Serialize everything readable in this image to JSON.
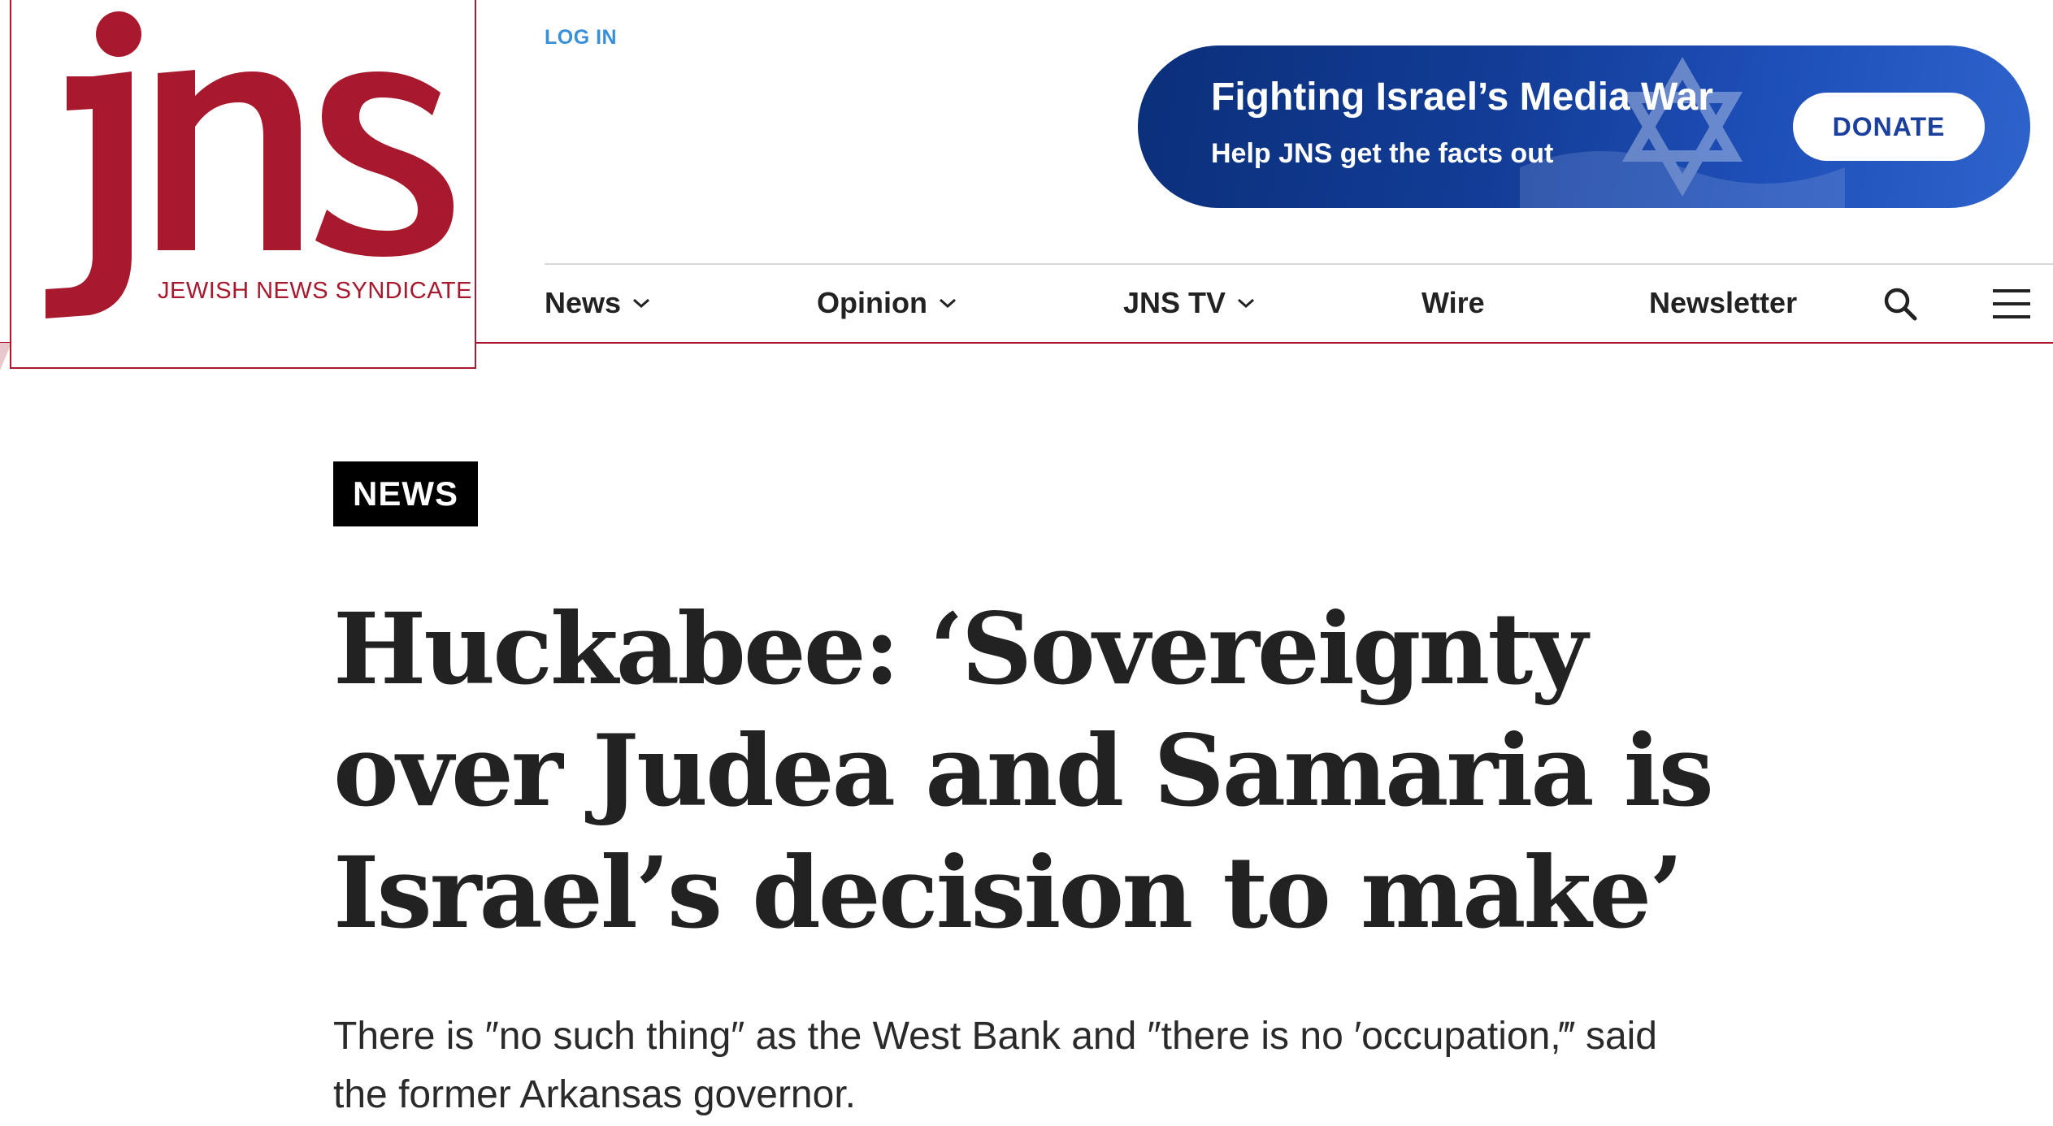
{
  "logo": {
    "wordmark": "jns",
    "tagline": "JEWISH NEWS SYNDICATE"
  },
  "header": {
    "login_label": "LOG IN"
  },
  "banner": {
    "title": "Fighting Israel’s Media War",
    "subtitle": "Help JNS get the facts out",
    "donate_label": "DONATE"
  },
  "nav": {
    "items": [
      {
        "label": "News",
        "dropdown": true
      },
      {
        "label": "Opinion",
        "dropdown": true
      },
      {
        "label": "JNS TV",
        "dropdown": true
      },
      {
        "label": "Wire",
        "dropdown": false
      },
      {
        "label": "Newsletter",
        "dropdown": false
      }
    ],
    "search_icon": "search-icon",
    "menu_icon": "hamburger-menu-icon"
  },
  "article": {
    "category": "NEWS",
    "headline_lines": [
      "Huckabee: ‘Sovereignty",
      "over Judea and Samaria is",
      "Israel’s decision to make’"
    ],
    "dek_lines": [
      "There is ″no such thing″ as the West Bank and ″there is no ′occupation,‴ said",
      "the former Arkansas governor."
    ]
  },
  "colors": {
    "brand_red": "#a8192e",
    "banner_blue": "#123c96",
    "login_blue": "#3a8fd9",
    "text_dark": "#222222"
  }
}
